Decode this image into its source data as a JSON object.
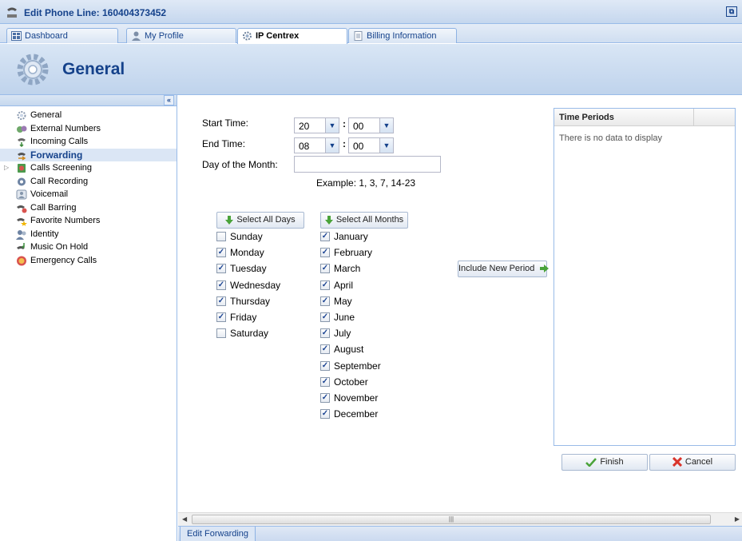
{
  "window": {
    "title": "Edit Phone Line: 160404373452"
  },
  "tabs": [
    {
      "label": "Dashboard",
      "icon": "dashboard-icon"
    },
    {
      "label": "My Profile",
      "icon": "user-icon"
    },
    {
      "label": "IP Centrex",
      "icon": "gear-icon"
    },
    {
      "label": "Billing Information",
      "icon": "document-icon"
    }
  ],
  "header": {
    "title": "General"
  },
  "sidebar": {
    "items": [
      {
        "label": "General",
        "icon": "gear-icon"
      },
      {
        "label": "External Numbers",
        "icon": "numbers-icon"
      },
      {
        "label": "Incoming Calls",
        "icon": "incoming-call-icon"
      },
      {
        "label": "Forwarding",
        "icon": "forwarding-icon",
        "selected": true
      },
      {
        "label": "Calls Screening",
        "icon": "screening-icon"
      },
      {
        "label": "Call Recording",
        "icon": "recording-icon"
      },
      {
        "label": "Voicemail",
        "icon": "voicemail-icon"
      },
      {
        "label": "Call Barring",
        "icon": "barring-icon"
      },
      {
        "label": "Favorite Numbers",
        "icon": "favorite-icon"
      },
      {
        "label": "Identity",
        "icon": "identity-icon"
      },
      {
        "label": "Music On Hold",
        "icon": "music-icon"
      },
      {
        "label": "Emergency Calls",
        "icon": "emergency-icon"
      }
    ]
  },
  "form": {
    "start_label": "Start Time:",
    "start_hour": "20",
    "start_minute": "00",
    "end_label": "End Time:",
    "end_hour": "08",
    "end_minute": "00",
    "colon": ":",
    "day_label": "Day of the Month:",
    "day_value": "",
    "example": "Example: 1, 3, 7, 14-23"
  },
  "days": {
    "button": "Select All Days",
    "items": [
      {
        "label": "Sunday",
        "checked": false
      },
      {
        "label": "Monday",
        "checked": true
      },
      {
        "label": "Tuesday",
        "checked": true
      },
      {
        "label": "Wednesday",
        "checked": true
      },
      {
        "label": "Thursday",
        "checked": true
      },
      {
        "label": "Friday",
        "checked": true
      },
      {
        "label": "Saturday",
        "checked": false
      }
    ]
  },
  "months": {
    "button": "Select All Months",
    "items": [
      {
        "label": "January",
        "checked": true
      },
      {
        "label": "February",
        "checked": true
      },
      {
        "label": "March",
        "checked": true
      },
      {
        "label": "April",
        "checked": true
      },
      {
        "label": "May",
        "checked": true
      },
      {
        "label": "June",
        "checked": true
      },
      {
        "label": "July",
        "checked": true
      },
      {
        "label": "August",
        "checked": true
      },
      {
        "label": "September",
        "checked": true
      },
      {
        "label": "October",
        "checked": true
      },
      {
        "label": "November",
        "checked": true
      },
      {
        "label": "December",
        "checked": true
      }
    ]
  },
  "include_button": "Include New Period",
  "grid": {
    "column": "Time Periods",
    "empty": "There is no data to display"
  },
  "actions": {
    "finish": "Finish",
    "cancel": "Cancel"
  },
  "bottom_tab": "Edit Forwarding",
  "colors": {
    "accent": "#15428b",
    "border": "#99bbe8",
    "selected_bg": "#dbe6f5"
  }
}
